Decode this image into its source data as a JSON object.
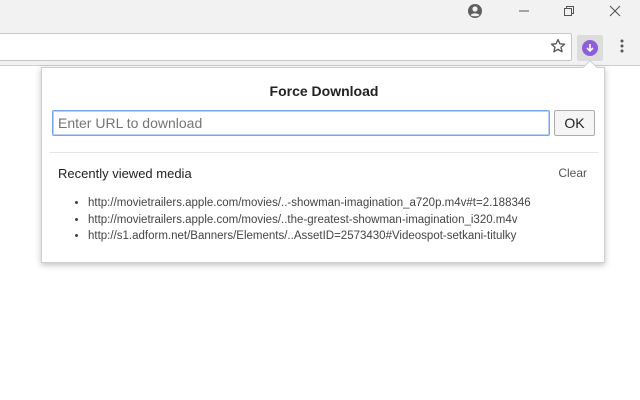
{
  "window": {
    "profile_icon": "profile-icon",
    "minimize_icon": "minimize-icon",
    "maximize_icon": "restore-icon",
    "close_icon": "close-icon"
  },
  "toolbar": {
    "bookmark_icon": "star-icon",
    "extension_icon": "download-icon",
    "menu_icon": "kebab-menu-icon",
    "extension_color": "#8e5dd9"
  },
  "popup": {
    "title": "Force Download",
    "url_input": {
      "value": "",
      "placeholder": "Enter URL to download"
    },
    "ok_label": "OK",
    "recent_heading": "Recently viewed media",
    "clear_label": "Clear",
    "media": [
      "http://movietrailers.apple.com/movies/..-showman-imagination_a720p.m4v#t=2.188346",
      "http://movietrailers.apple.com/movies/..the-greatest-showman-imagination_i320.m4v",
      "http://s1.adform.net/Banners/Elements/..AssetID=2573430#Videospot-setkani-titulky"
    ]
  }
}
